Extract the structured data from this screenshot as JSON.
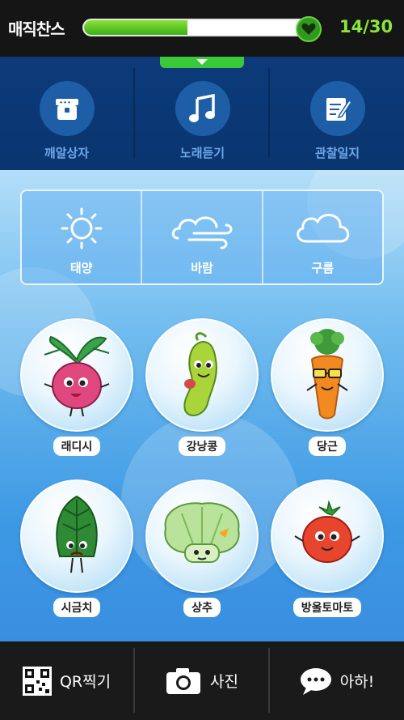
{
  "header": {
    "title": "매직찬스",
    "progress_fraction": 0.45,
    "counter": "14/30",
    "heart_icon": "heart-icon"
  },
  "toolbar": {
    "items": [
      {
        "label": "깨알상자",
        "icon": "treasure-box-icon"
      },
      {
        "label": "노래듣기",
        "icon": "music-note-icon"
      },
      {
        "label": "관찰일지",
        "icon": "journal-pencil-icon"
      }
    ]
  },
  "weather": {
    "items": [
      {
        "label": "태양",
        "icon": "sun-icon"
      },
      {
        "label": "바람",
        "icon": "wind-cloud-icon"
      },
      {
        "label": "구름",
        "icon": "cloud-icon"
      }
    ]
  },
  "vegetables": [
    {
      "label": "래디시",
      "icon": "radish-character"
    },
    {
      "label": "강낭콩",
      "icon": "bean-character"
    },
    {
      "label": "당근",
      "icon": "carrot-character"
    },
    {
      "label": "시금치",
      "icon": "spinach-character"
    },
    {
      "label": "상추",
      "icon": "lettuce-character"
    },
    {
      "label": "방울토마토",
      "icon": "cherry-tomato-character"
    }
  ],
  "bottom": {
    "items": [
      {
        "label": "QR찍기",
        "icon": "qr-code-icon"
      },
      {
        "label": "사진",
        "icon": "camera-icon"
      },
      {
        "label": "아하!",
        "icon": "speech-bubble-icon"
      }
    ]
  },
  "colors": {
    "accent_green": "#3ab016",
    "toolbar_blue": "#0c3a7a",
    "counter_green": "#8ae639"
  }
}
